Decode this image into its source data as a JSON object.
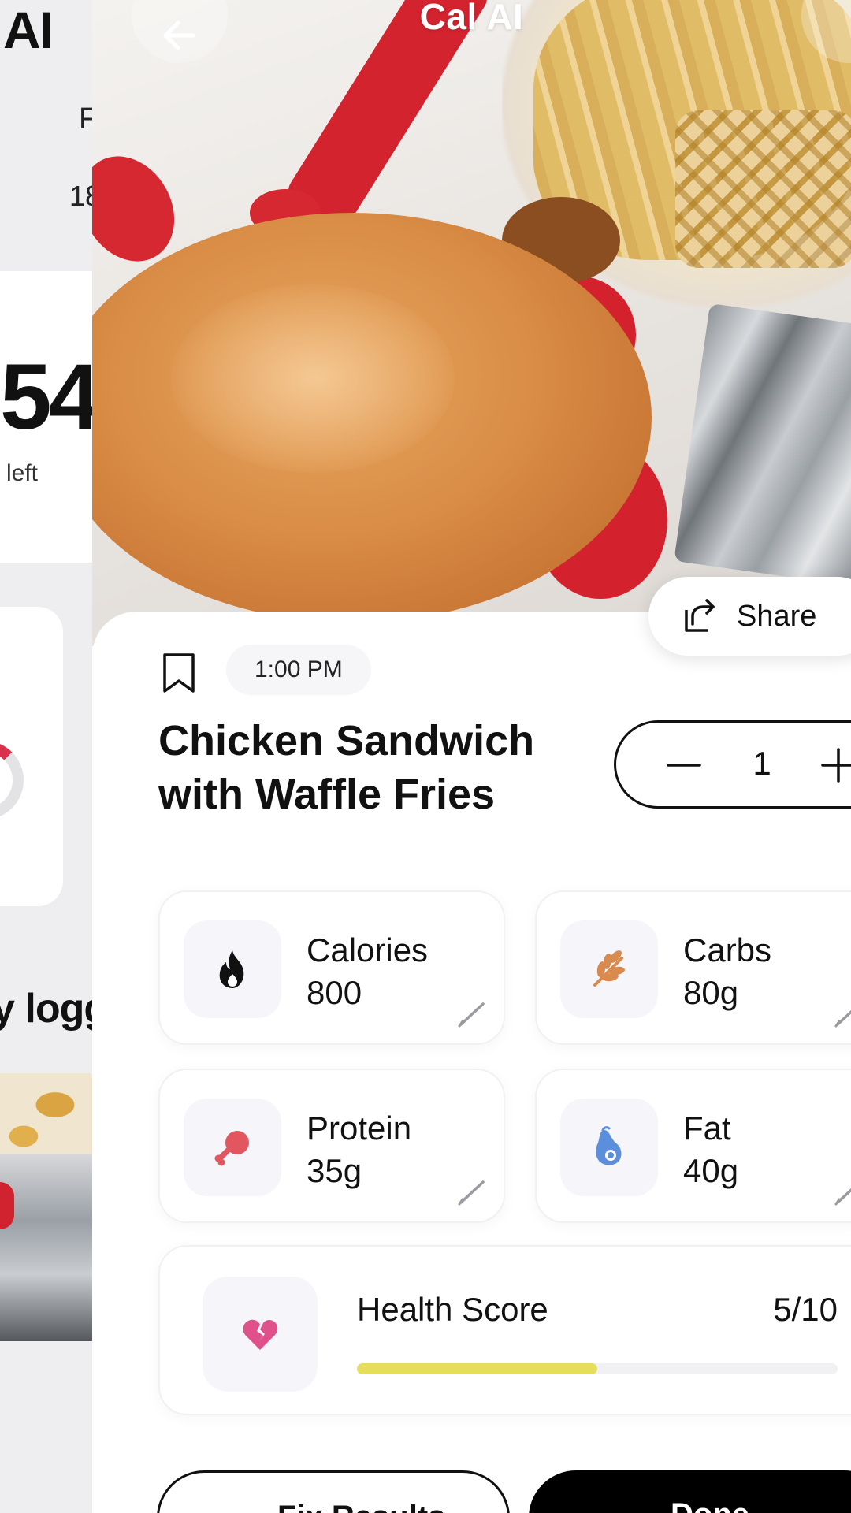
{
  "background_app": {
    "title": "AI",
    "partial_letter": "F",
    "partial_number": "18",
    "big_number": "54",
    "left_label": "left",
    "section_partial": "y logg"
  },
  "header": {
    "title": "Cal AI"
  },
  "share": {
    "label": "Share"
  },
  "meal": {
    "time": "1:00 PM",
    "name": "Chicken Sandwich with Waffle Fries",
    "quantity": "1"
  },
  "macros": {
    "calories": {
      "label": "Calories",
      "value": "800",
      "icon": "flame-icon",
      "color": "#111111"
    },
    "carbs": {
      "label": "Carbs",
      "value": "80g",
      "icon": "wheat-icon",
      "color": "#d98a4e"
    },
    "protein": {
      "label": "Protein",
      "value": "35g",
      "icon": "drumstick-icon",
      "color": "#e25660"
    },
    "fat": {
      "label": "Fat",
      "value": "40g",
      "icon": "avocado-icon",
      "color": "#5b8fde"
    }
  },
  "health_score": {
    "label": "Health Score",
    "score_text": "5/10",
    "fraction": 0.5,
    "bar_color": "#e5de5c",
    "icon": "heart-broken-icon",
    "icon_color": "#e0508a"
  },
  "actions": {
    "fix_label": "Fix Results",
    "done_label": "Done"
  }
}
